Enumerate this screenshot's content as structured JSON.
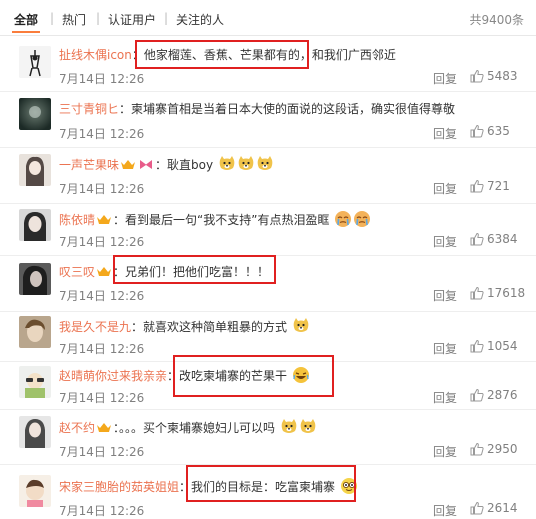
{
  "tabs": [
    "全部",
    "热门",
    "认证用户",
    "关注的人"
  ],
  "total": "共9400条",
  "reply_label": "回复",
  "comments": [
    {
      "user": "扯线木偶icon",
      "text": "他家榴莲、香蕉、芒果都有的，",
      "text2": "和我们广西邻近",
      "date": "7月14日 12:26",
      "likes": "5483",
      "vip": false
    },
    {
      "user": "三寸青铜ヒ",
      "text": "柬埔寨首相是当着日本大使的面说的这段话，确实很值得尊敬",
      "date": "7月14日 12:26",
      "likes": "635",
      "vip": false
    },
    {
      "user": "一声芒果味",
      "text": "耿直boy",
      "date": "7月14日 12:26",
      "likes": "721",
      "vip": true
    },
    {
      "user": "陈依晴",
      "text": "看到最后一句“我不支持”有点热泪盈眶",
      "date": "7月14日 12:26",
      "likes": "6384",
      "vip": true
    },
    {
      "user": "叹三叹",
      "text": "兄弟们！把他们吃富！！！",
      "date": "7月14日 12:26",
      "likes": "17618",
      "vip": true
    },
    {
      "user": "我是久不是九",
      "text": "就喜欢这种简单粗暴的方式",
      "date": "7月14日 12:26",
      "likes": "1054",
      "vip": false
    },
    {
      "user": "赵晴萌你过来我亲亲",
      "text": "改吃柬埔寨的芒果干",
      "date": "7月14日 12:26",
      "likes": "2876",
      "vip": false
    },
    {
      "user": "赵不约",
      "text": "。。。买个柬埔寨媳妇儿可以吗",
      "date": "7月14日 12:26",
      "likes": "2950",
      "vip": true
    },
    {
      "user": "宋家三胞胎的茹英姐姐",
      "text": "我们的目标是：吃富柬埔寨",
      "date": "7月14日 12:26",
      "likes": "2614",
      "vip": false
    }
  ]
}
